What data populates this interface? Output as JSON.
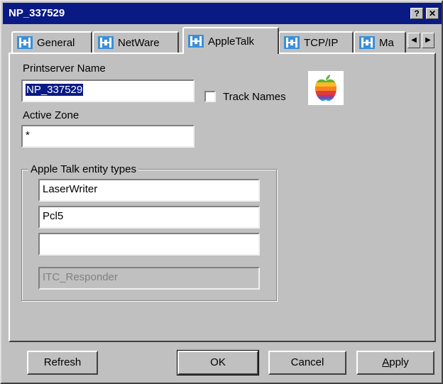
{
  "window": {
    "title": "NP_337529",
    "help_label": "?",
    "close_label": "✕"
  },
  "tabs": [
    {
      "label": "General",
      "icon": "network-icon"
    },
    {
      "label": "NetWare",
      "icon": "network-icon"
    },
    {
      "label": "AppleTalk",
      "icon": "network-icon",
      "active": true
    },
    {
      "label": "TCP/IP",
      "icon": "network-icon"
    },
    {
      "label": "Ma",
      "icon": "network-icon"
    }
  ],
  "tab_scroll": {
    "left_label": "◀",
    "right_label": "▶"
  },
  "form": {
    "printserver_name_label": "Printserver Name",
    "printserver_name_value": "NP_337529",
    "track_names_label": "Track Names",
    "track_names_checked": false,
    "active_zone_label": "Active Zone",
    "active_zone_value": "*"
  },
  "entity_types": {
    "group_label": "Apple Talk entity types",
    "entries": [
      "LaserWriter",
      "Pcl5",
      "",
      "ITC_Responder"
    ]
  },
  "buttons": {
    "refresh": "Refresh",
    "ok": "OK",
    "cancel": "Cancel",
    "apply": "Apply"
  },
  "colors": {
    "titlebar": "#0a1a84",
    "face": "#c0c0c0",
    "selection": "#0a1a84"
  }
}
